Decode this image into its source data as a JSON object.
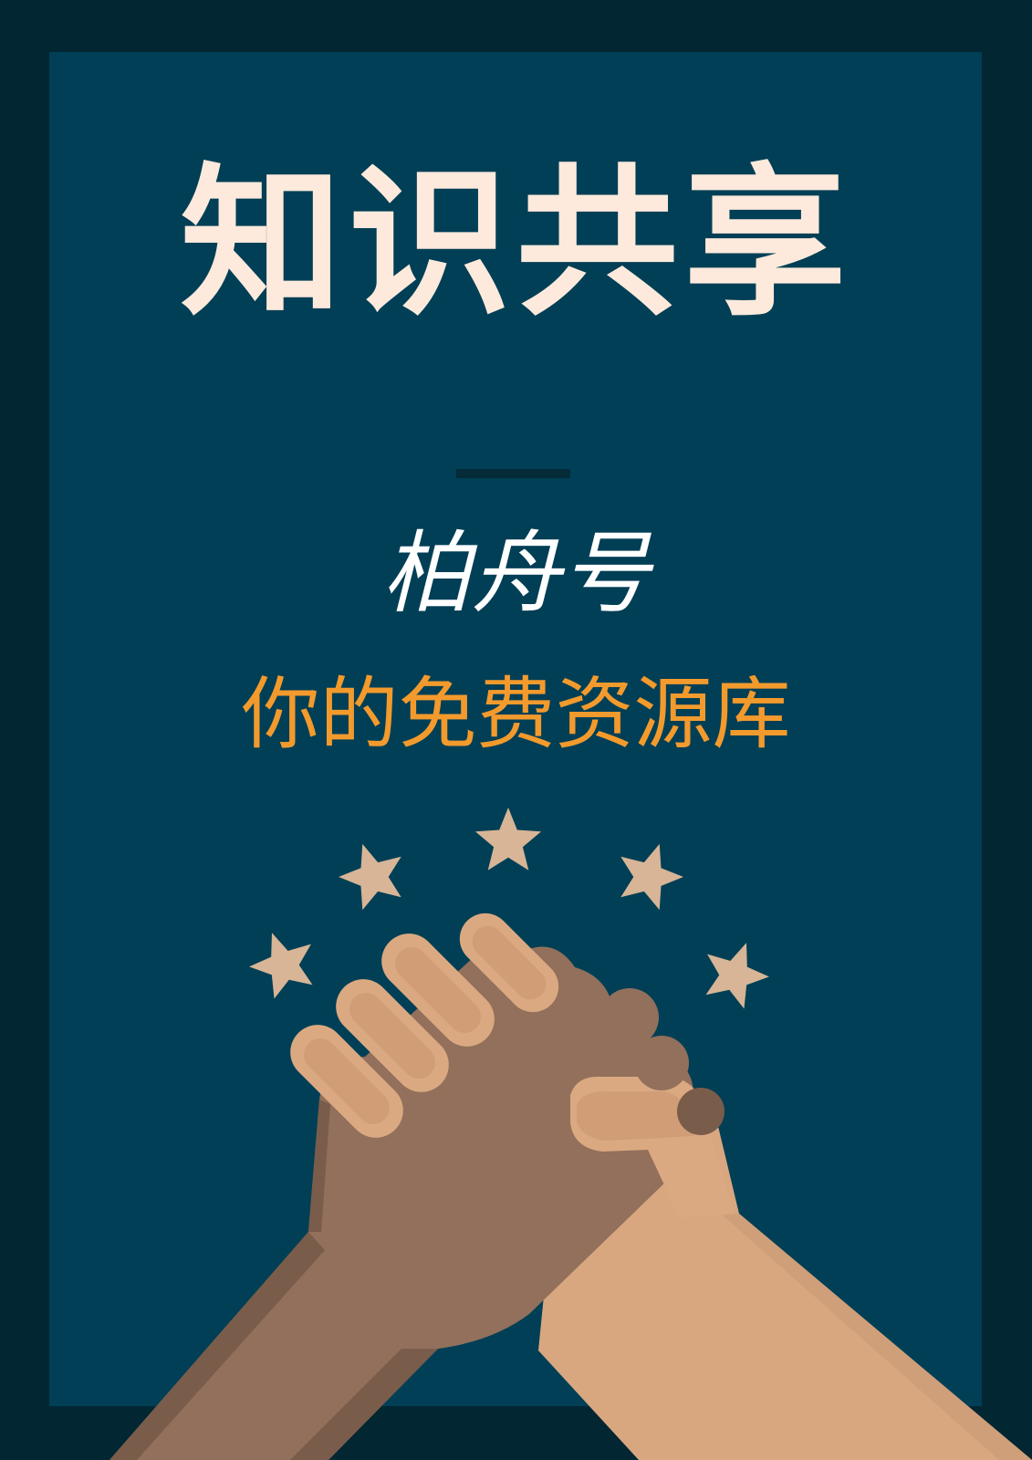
{
  "poster": {
    "title": "知识共享",
    "subtitle": "柏舟号",
    "tagline": "你的免费资源库"
  },
  "icons": [
    "star-icon",
    "handshake-icon"
  ],
  "colors": {
    "background_dark": "#022632",
    "panel": "#013f56",
    "title": "#fdeadc",
    "subtitle": "#ffffff",
    "tagline": "#f39a2d",
    "star": "#d7b596",
    "hand_dark": "#92705b",
    "hand_light": "#d8a780"
  }
}
